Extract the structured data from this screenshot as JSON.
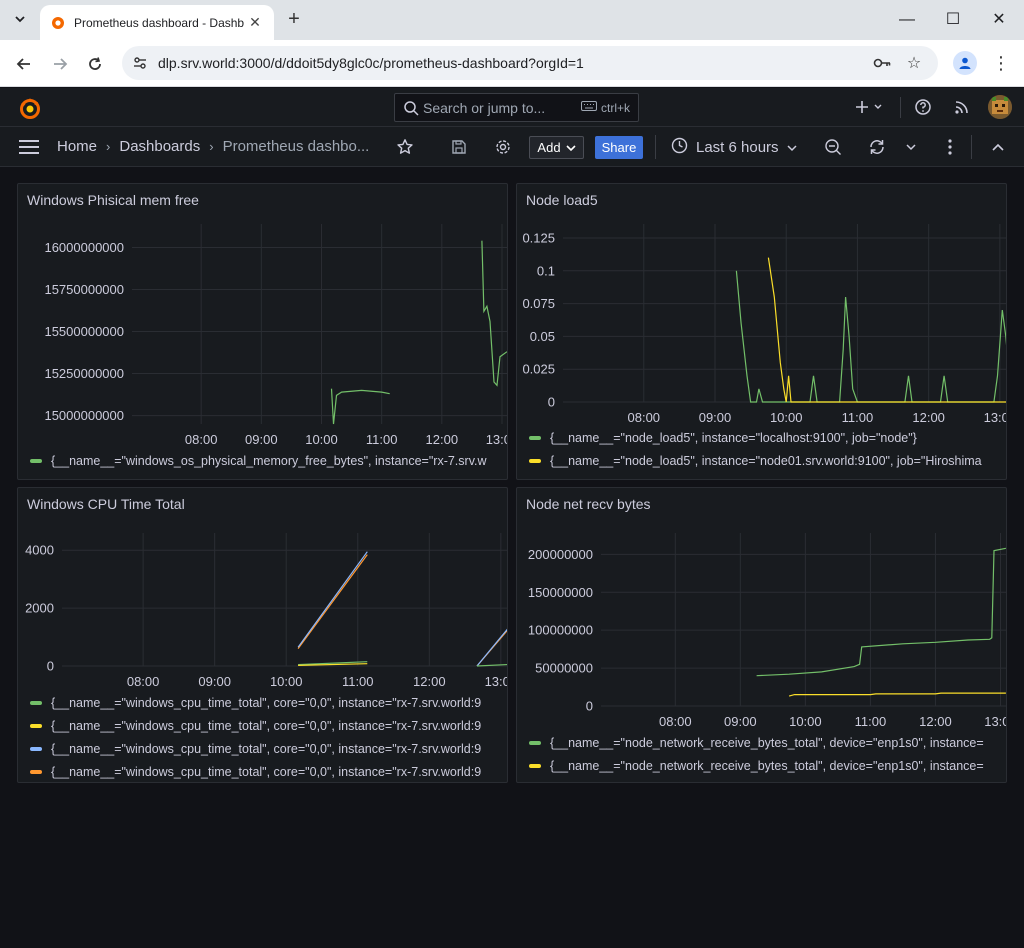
{
  "browser": {
    "tab_title": "Prometheus dashboard - Dashb",
    "url": "dlp.srv.world:3000/d/ddoit5dy8glc0c/prometheus-dashboard?orgId=1"
  },
  "grafana": {
    "search_placeholder": "Search or jump to...",
    "search_shortcut": "ctrl+k",
    "breadcrumbs": [
      "Home",
      "Dashboards",
      "Prometheus dashbo..."
    ],
    "add_label": "Add",
    "share_label": "Share",
    "time_range": "Last 6 hours"
  },
  "colors": {
    "green": "#73bf69",
    "yellow": "#fade2a",
    "blue": "#8ab8ff",
    "orange": "#ff9830",
    "grid": "#2a2d33"
  },
  "panels": [
    {
      "title": "Windows Phisical mem free",
      "legend": [
        "{__name__=\"windows_os_physical_memory_free_bytes\", instance=\"rx-7.srv.w"
      ],
      "chart_data": {
        "type": "line",
        "x_ticks": [
          "08:00",
          "09:00",
          "10:00",
          "11:00",
          "12:00",
          "13:00"
        ],
        "y_ticks": [
          "15000000000",
          "15250000000",
          "15500000000",
          "15750000000",
          "16000000000"
        ],
        "ylim": [
          14950000000,
          16080000000
        ],
        "series": [
          {
            "color": "green",
            "points": [
              [
                "10:10",
                15160000000
              ],
              [
                "10:12",
                14950000000
              ],
              [
                "10:15",
                15120000000
              ],
              [
                "10:20",
                15140000000
              ],
              [
                "10:40",
                15150000000
              ],
              [
                "11:00",
                15140000000
              ],
              [
                "11:08",
                15130000000
              ]
            ]
          },
          {
            "color": "green",
            "points": [
              [
                "12:40",
                16040000000
              ],
              [
                "12:42",
                15620000000
              ],
              [
                "12:45",
                15650000000
              ],
              [
                "12:48",
                15560000000
              ],
              [
                "12:52",
                15200000000
              ],
              [
                "12:55",
                15180000000
              ],
              [
                "12:58",
                15350000000
              ],
              [
                "13:05",
                15380000000
              ]
            ]
          }
        ]
      }
    },
    {
      "title": "Node load5",
      "legend": [
        "{__name__=\"node_load5\", instance=\"localhost:9100\", job=\"node\"}",
        "{__name__=\"node_load5\", instance=\"node01.srv.world:9100\", job=\"Hiroshima"
      ],
      "chart_data": {
        "type": "line",
        "x_ticks": [
          "08:00",
          "09:00",
          "10:00",
          "11:00",
          "12:00",
          "13:00"
        ],
        "y_ticks": [
          "0",
          "0.025",
          "0.05",
          "0.075",
          "0.1",
          "0.125"
        ],
        "ylim": [
          0,
          0.128
        ],
        "series": [
          {
            "color": "green",
            "points": [
              [
                "09:18",
                0.1
              ],
              [
                "09:22",
                0.06
              ],
              [
                "09:27",
                0.02
              ],
              [
                "09:30",
                0
              ],
              [
                "09:35",
                0
              ],
              [
                "09:37",
                0.01
              ],
              [
                "09:40",
                0
              ],
              [
                "10:20",
                0
              ],
              [
                "10:23",
                0.02
              ],
              [
                "10:26",
                0
              ],
              [
                "10:45",
                0
              ],
              [
                "10:48",
                0.04
              ],
              [
                "10:50",
                0.08
              ],
              [
                "10:53",
                0.05
              ],
              [
                "10:56",
                0.01
              ],
              [
                "11:00",
                0
              ],
              [
                "11:40",
                0
              ],
              [
                "11:43",
                0.02
              ],
              [
                "11:46",
                0
              ],
              [
                "12:10",
                0
              ],
              [
                "12:13",
                0.02
              ],
              [
                "12:16",
                0
              ],
              [
                "12:55",
                0
              ],
              [
                "12:58",
                0.02
              ],
              [
                "13:02",
                0.07
              ],
              [
                "13:05",
                0.05
              ],
              [
                "13:10",
                0
              ]
            ]
          },
          {
            "color": "yellow",
            "points": [
              [
                "09:45",
                0.11
              ],
              [
                "09:50",
                0.08
              ],
              [
                "09:55",
                0.03
              ],
              [
                "09:58",
                0.01
              ],
              [
                "10:00",
                0
              ],
              [
                "10:02",
                0.02
              ],
              [
                "10:04",
                0
              ],
              [
                "13:10",
                0
              ]
            ]
          }
        ]
      }
    },
    {
      "title": "Windows CPU Time Total",
      "legend": [
        "{__name__=\"windows_cpu_time_total\", core=\"0,0\", instance=\"rx-7.srv.world:9",
        "{__name__=\"windows_cpu_time_total\", core=\"0,0\", instance=\"rx-7.srv.world:9",
        "{__name__=\"windows_cpu_time_total\", core=\"0,0\", instance=\"rx-7.srv.world:9",
        "{__name__=\"windows_cpu_time_total\", core=\"0,0\", instance=\"rx-7.srv.world:9"
      ],
      "chart_data": {
        "type": "line",
        "x_ticks": [
          "08:00",
          "09:00",
          "10:00",
          "11:00",
          "12:00",
          "13:00"
        ],
        "y_ticks": [
          "0",
          "2000",
          "4000"
        ],
        "ylim": [
          0,
          4250
        ],
        "series": [
          {
            "color": "orange",
            "points": [
              [
                "10:10",
                600
              ],
              [
                "11:08",
                3850
              ]
            ]
          },
          {
            "color": "blue",
            "points": [
              [
                "10:10",
                650
              ],
              [
                "11:08",
                3950
              ]
            ]
          },
          {
            "color": "green",
            "points": [
              [
                "10:10",
                50
              ],
              [
                "11:08",
                150
              ]
            ]
          },
          {
            "color": "yellow",
            "points": [
              [
                "10:10",
                20
              ],
              [
                "11:08",
                80
              ]
            ]
          },
          {
            "color": "orange",
            "points": [
              [
                "12:40",
                0
              ],
              [
                "13:10",
                1450
              ]
            ]
          },
          {
            "color": "blue",
            "points": [
              [
                "12:40",
                0
              ],
              [
                "13:10",
                1500
              ]
            ]
          },
          {
            "color": "green",
            "points": [
              [
                "12:40",
                0
              ],
              [
                "13:10",
                60
              ]
            ]
          }
        ]
      }
    },
    {
      "title": "Node net recv bytes",
      "legend": [
        "{__name__=\"node_network_receive_bytes_total\", device=\"enp1s0\", instance=",
        "{__name__=\"node_network_receive_bytes_total\", device=\"enp1s0\", instance="
      ],
      "chart_data": {
        "type": "line",
        "x_ticks": [
          "08:00",
          "09:00",
          "10:00",
          "11:00",
          "12:00",
          "13:00"
        ],
        "y_ticks": [
          "0",
          "50000000",
          "100000000",
          "150000000",
          "200000000"
        ],
        "ylim": [
          0,
          215000000
        ],
        "series": [
          {
            "color": "green",
            "points": [
              [
                "09:15",
                40000000
              ],
              [
                "09:45",
                42000000
              ],
              [
                "10:15",
                45000000
              ],
              [
                "10:45",
                52000000
              ],
              [
                "10:50",
                55000000
              ],
              [
                "10:52",
                78000000
              ],
              [
                "11:30",
                82000000
              ],
              [
                "12:00",
                84000000
              ],
              [
                "12:30",
                87000000
              ],
              [
                "12:50",
                88000000
              ],
              [
                "12:52",
                90000000
              ],
              [
                "12:54",
                205000000
              ],
              [
                "13:05",
                208000000
              ]
            ]
          },
          {
            "color": "yellow",
            "points": [
              [
                "09:45",
                13000000
              ],
              [
                "09:50",
                15000000
              ],
              [
                "10:30",
                15000000
              ],
              [
                "11:00",
                15000000
              ],
              [
                "11:05",
                16000000
              ],
              [
                "12:00",
                16000000
              ],
              [
                "12:05",
                17000000
              ],
              [
                "13:05",
                17000000
              ]
            ]
          }
        ]
      }
    }
  ]
}
